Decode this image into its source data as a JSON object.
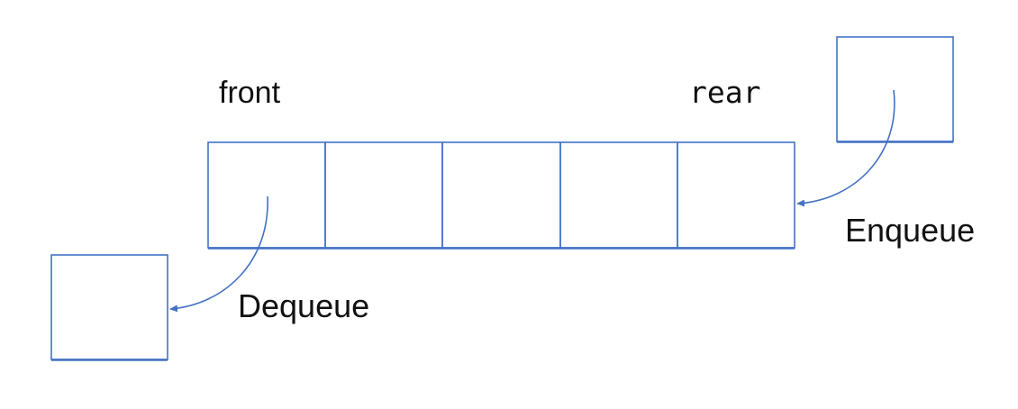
{
  "diagram": {
    "labels": {
      "front": "front",
      "rear": "rear",
      "enqueue": "Enqueue",
      "dequeue": "Dequeue"
    },
    "queue_cells": 5,
    "colors": {
      "stroke": "#4472C4",
      "text": "#111111",
      "background": "#ffffff"
    }
  }
}
